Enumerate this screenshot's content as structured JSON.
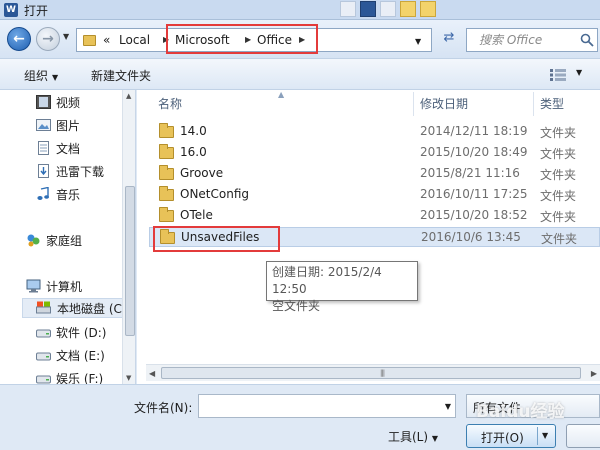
{
  "window": {
    "title": "打开"
  },
  "nav": {
    "history_arrow": "▼",
    "address": {
      "root_marker": "«",
      "segments": [
        "Local",
        "Microsoft",
        "Office"
      ]
    },
    "search_placeholder": "搜索 Office"
  },
  "toolbar": {
    "organize_label": "组织",
    "new_folder_label": "新建文件夹"
  },
  "sidebar": {
    "items": [
      {
        "label": "视频",
        "icon": "video-icon"
      },
      {
        "label": "图片",
        "icon": "pictures-icon"
      },
      {
        "label": "文档",
        "icon": "documents-icon"
      },
      {
        "label": "迅雷下载",
        "icon": "download-icon"
      },
      {
        "label": "音乐",
        "icon": "music-icon"
      },
      {
        "label": "家庭组",
        "icon": "homegroup-icon"
      },
      {
        "label": "计算机",
        "icon": "computer-icon"
      },
      {
        "label": "本地磁盘 (C",
        "icon": "local-disk-icon",
        "selected": true
      },
      {
        "label": "软件 (D:)",
        "icon": "drive-icon"
      },
      {
        "label": "文档 (E:)",
        "icon": "drive-icon"
      },
      {
        "label": "娱乐 (F:)",
        "icon": "drive-icon"
      }
    ]
  },
  "file_list": {
    "columns": {
      "name": "名称",
      "modified": "修改日期",
      "type": "类型"
    },
    "rows": [
      {
        "name": "14.0",
        "modified": "2014/12/11 18:19",
        "type": "文件夹"
      },
      {
        "name": "16.0",
        "modified": "2015/10/20 18:49",
        "type": "文件夹"
      },
      {
        "name": "Groove",
        "modified": "2015/8/21 11:16",
        "type": "文件夹"
      },
      {
        "name": "ONetConfig",
        "modified": "2016/10/11 17:25",
        "type": "文件夹"
      },
      {
        "name": "OTele",
        "modified": "2015/10/20 18:52",
        "type": "文件夹"
      },
      {
        "name": "UnsavedFiles",
        "modified": "2016/10/6 13:45",
        "type": "文件夹",
        "highlighted": true
      }
    ],
    "tooltip": {
      "line1": "创建日期: 2015/2/4 12:50",
      "line2": "空文件夹"
    }
  },
  "footer": {
    "filename_label": "文件名(N):",
    "filename_value": "",
    "filter_label": "所有文件",
    "tools_label": "工具(L)",
    "open_label": "打开(O)",
    "cancel_label": ""
  },
  "watermark": "Baidu经验",
  "colors": {
    "annotation_red": "#e33b3b",
    "selection": "#dbe7f6",
    "folder": "#e8c258"
  }
}
